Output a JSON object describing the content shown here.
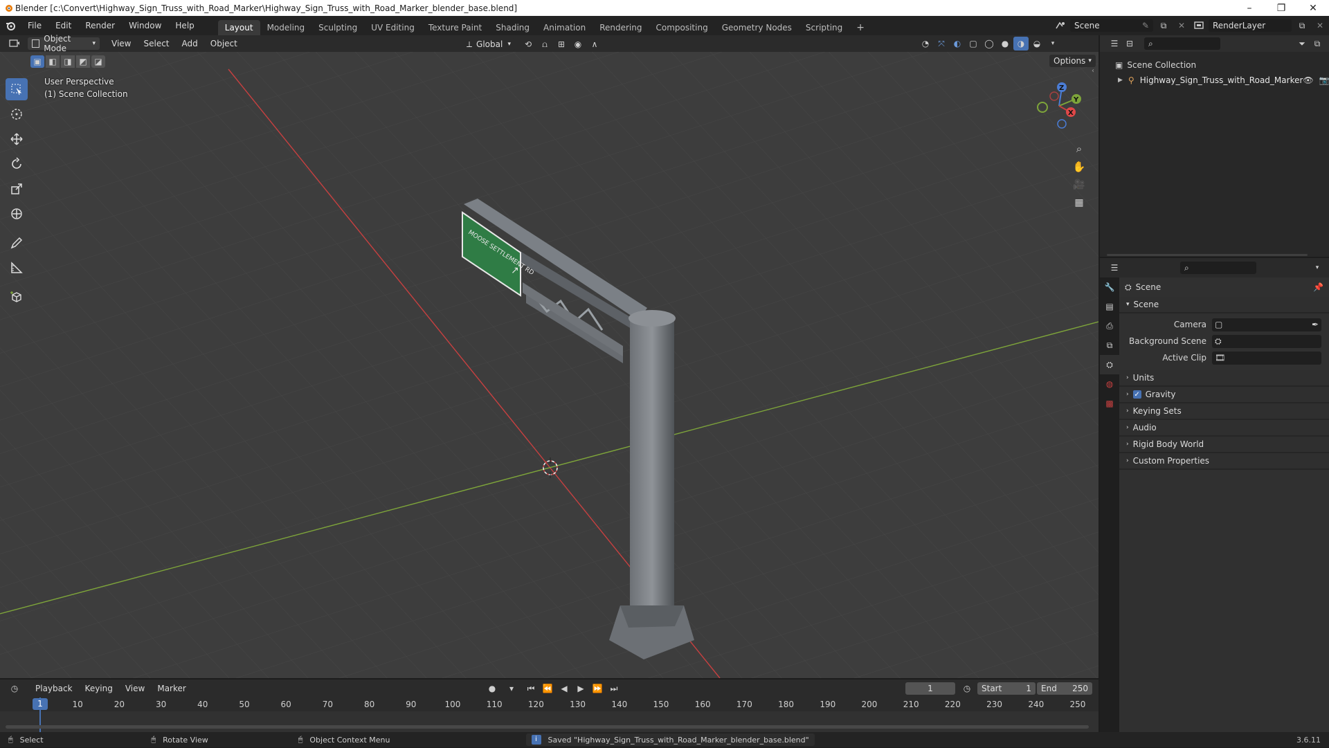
{
  "window": {
    "title": "Blender [c:\\Convert\\Highway_Sign_Truss_with_Road_Marker\\Highway_Sign_Truss_with_Road_Marker_blender_base.blend]"
  },
  "menu": [
    "File",
    "Edit",
    "Render",
    "Window",
    "Help"
  ],
  "workspaces": [
    "Layout",
    "Modeling",
    "Sculpting",
    "UV Editing",
    "Texture Paint",
    "Shading",
    "Animation",
    "Rendering",
    "Compositing",
    "Geometry Nodes",
    "Scripting"
  ],
  "active_workspace": "Layout",
  "scene_name": "Scene",
  "render_layer": "RenderLayer",
  "viewport": {
    "mode": "Object Mode",
    "menus": [
      "View",
      "Select",
      "Add",
      "Object"
    ],
    "orientation": "Global",
    "options_label": "Options",
    "perspective_label": "User Perspective",
    "collection_label": "(1) Scene Collection",
    "sign_text": "MOOSE SETTLEMENT RD"
  },
  "gizmo": {
    "x": "X",
    "y": "Y",
    "z": "Z"
  },
  "outliner": {
    "root": "Scene Collection",
    "item": "Highway_Sign_Truss_with_Road_Marker"
  },
  "properties": {
    "header": "Scene",
    "section": "Scene",
    "rows": [
      {
        "label": "Camera"
      },
      {
        "label": "Background Scene"
      },
      {
        "label": "Active Clip"
      }
    ],
    "panels": [
      "Units",
      "Gravity",
      "Keying Sets",
      "Audio",
      "Rigid Body World",
      "Custom Properties"
    ],
    "gravity_checked": true
  },
  "timeline": {
    "menus": [
      "Playback",
      "Keying",
      "View",
      "Marker"
    ],
    "current_frame": "1",
    "start_label": "Start",
    "start_value": "1",
    "end_label": "End",
    "end_value": "250",
    "ruler": [
      "1",
      "10",
      "20",
      "30",
      "40",
      "50",
      "60",
      "70",
      "80",
      "90",
      "100",
      "110",
      "120",
      "130",
      "140",
      "150",
      "160",
      "170",
      "180",
      "190",
      "200",
      "210",
      "220",
      "230",
      "240",
      "250"
    ],
    "playhead_frame": 1
  },
  "status": {
    "select": "Select",
    "rotate": "Rotate View",
    "context": "Object Context Menu",
    "message": "Saved \"Highway_Sign_Truss_with_Road_Marker_blender_base.blend\"",
    "version": "3.6.11"
  },
  "colors": {
    "accent": "#4772b3",
    "x_axis": "#c74040",
    "y_axis": "#7ea53a",
    "sign_green": "#2f7c45"
  }
}
